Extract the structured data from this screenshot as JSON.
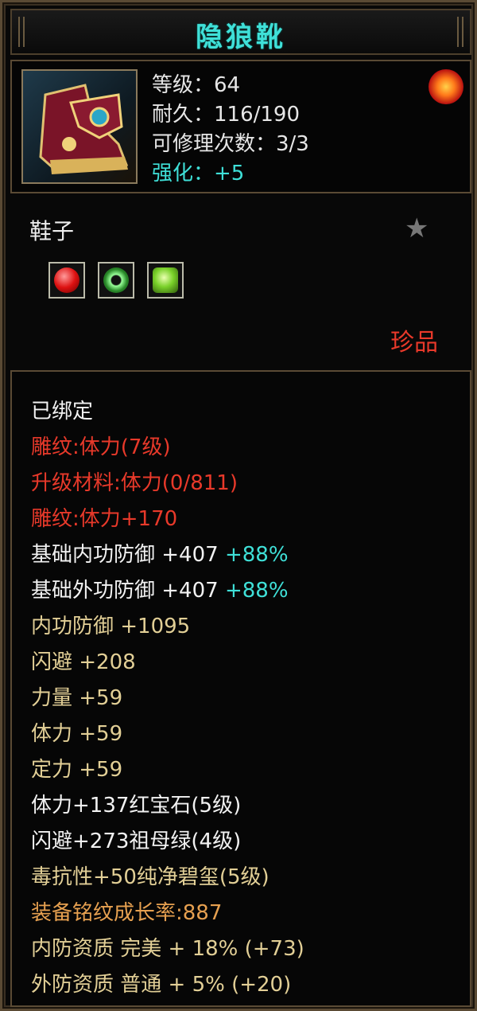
{
  "title": "隐狼靴",
  "item": {
    "icon": "boots-icon",
    "stats": [
      {
        "text": "等级：64",
        "color": "#e6e6e6"
      },
      {
        "text": "耐久：116/190",
        "color": "#e6e6e6"
      },
      {
        "text": "可修理次数：3/3",
        "color": "#e6e6e6"
      },
      {
        "text": "强化：+5",
        "color": "#3fe0d8"
      }
    ],
    "badge_icon": "flame-badge-icon"
  },
  "type_label": "鞋子",
  "star_icon": "star-icon",
  "gems": [
    "ruby-gem-icon",
    "emerald-ring-icon",
    "jade-gem-icon"
  ],
  "rarity": "珍品",
  "attributes": [
    {
      "text": "已绑定",
      "cls": "c-white"
    },
    {
      "text": "雕纹:体力(7级)",
      "cls": "c-red"
    },
    {
      "text": "升级材料:体力(0/811)",
      "cls": "c-red"
    },
    {
      "text": "雕纹:体力+170",
      "cls": "c-red"
    },
    {
      "text": "基础内功防御 +407",
      "pct": "+88%",
      "cls": "c-white"
    },
    {
      "text": "基础外功防御 +407",
      "pct": "+88%",
      "cls": "c-white"
    },
    {
      "text": "内功防御 +1095",
      "cls": "c-tan"
    },
    {
      "text": "闪避 +208",
      "cls": "c-tan"
    },
    {
      "text": "力量 +59",
      "cls": "c-tan"
    },
    {
      "text": "体力 +59",
      "cls": "c-tan"
    },
    {
      "text": "定力 +59",
      "cls": "c-tan"
    },
    {
      "text": "体力+137红宝石(5级)",
      "cls": "c-white"
    },
    {
      "text": "闪避+273祖母绿(4级)",
      "cls": "c-white"
    },
    {
      "text": "毒抗性+50纯净碧玺(5级)",
      "cls": "c-tan"
    },
    {
      "text": "装备铭纹成长率:887",
      "cls": "c-orange"
    },
    {
      "text": "内防资质 完美 + 18% (+73)",
      "cls": "c-tan"
    },
    {
      "text": "外防资质 普通 + 5% (+20)",
      "cls": "c-tan"
    }
  ]
}
